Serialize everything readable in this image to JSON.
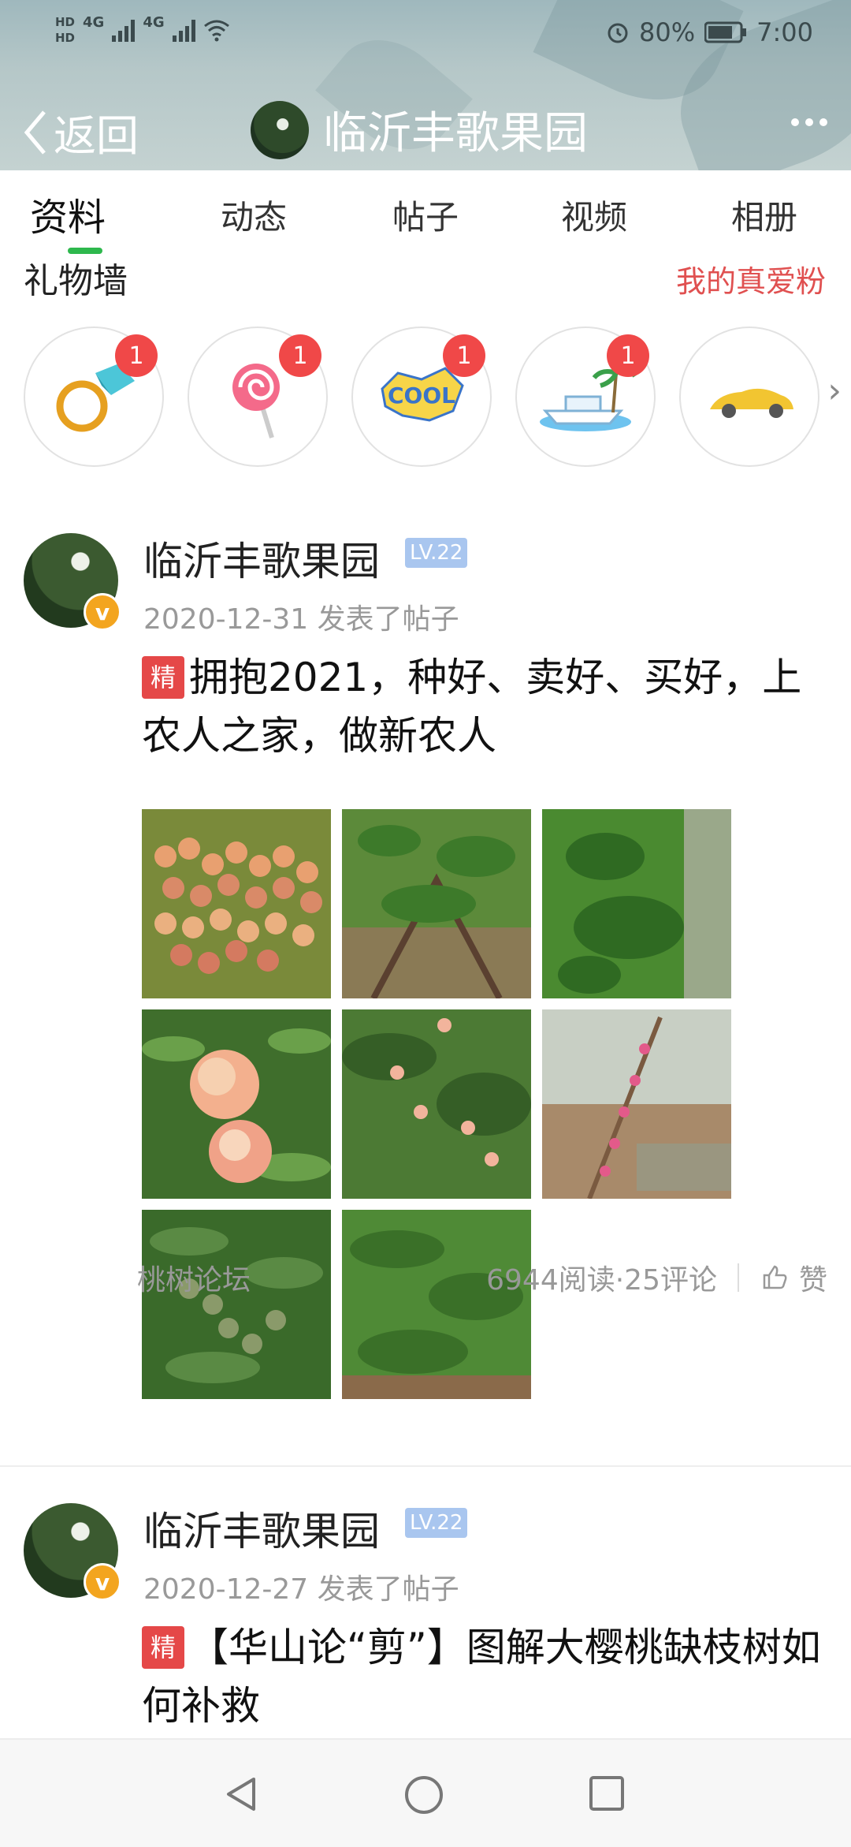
{
  "status": {
    "network_left": "HD",
    "network_4g": "4G",
    "battery": "80%",
    "time": "7:00"
  },
  "header": {
    "back_label": "返回",
    "title": "临沂丰歌果园"
  },
  "tabs": [
    "资料",
    "动态",
    "帖子",
    "视频",
    "相册"
  ],
  "gifts": {
    "title": "礼物墙",
    "fans_link": "我的真爱粉",
    "items": [
      {
        "name": "ring-gift-icon",
        "count": "1"
      },
      {
        "name": "lollipop-gift-icon",
        "count": "1"
      },
      {
        "name": "cool-sticker-gift-icon",
        "count": "1"
      },
      {
        "name": "yacht-gift-icon",
        "count": "1"
      },
      {
        "name": "sports-car-gift-icon",
        "count": ""
      }
    ]
  },
  "posts": [
    {
      "author": "临沂丰歌果园",
      "level": "LV.22",
      "meta": "2020-12-31  发表了帖子",
      "tag": "精",
      "text": "拥抱2021，种好、卖好、买好，上农人之家，做新农人",
      "images": [
        "peaches-pile",
        "peach-tree-branches",
        "peach-tree-leaves",
        "peaches-on-branch",
        "peach-orchard-fruit",
        "peach-blossom-branch",
        "green-young-peaches",
        "peach-tree-foliage"
      ],
      "forum": "桃树论坛",
      "stats": "6944阅读·25评论",
      "like_label": "赞"
    },
    {
      "author": "临沂丰歌果园",
      "level": "LV.22",
      "meta": "2020-12-27  发表了帖子",
      "tag": "精",
      "text": "【华山论“剪”】图解大樱桃缺枝树如何补救"
    }
  ],
  "system_nav": [
    "back-nav-icon",
    "home-nav-icon",
    "recents-nav-icon"
  ]
}
